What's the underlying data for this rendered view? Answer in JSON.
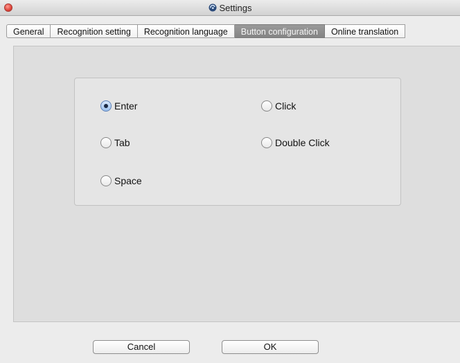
{
  "window": {
    "title": "Settings"
  },
  "tabs": [
    {
      "label": "General",
      "active": false
    },
    {
      "label": "Recognition setting",
      "active": false
    },
    {
      "label": "Recognition language",
      "active": false
    },
    {
      "label": "Button configuration",
      "active": true
    },
    {
      "label": "Online translation",
      "active": false
    }
  ],
  "options": {
    "enter": {
      "label": "Enter",
      "checked": true
    },
    "tab": {
      "label": "Tab",
      "checked": false
    },
    "space": {
      "label": "Space",
      "checked": false
    },
    "click": {
      "label": "Click",
      "checked": false
    },
    "double_click": {
      "label": "Double Click",
      "checked": false
    }
  },
  "buttons": {
    "cancel": "Cancel",
    "ok": "OK"
  },
  "colors": {
    "close": "#e0443a",
    "active_tab": "#8c8c8c",
    "radio_selected": "#9ec2ee"
  }
}
